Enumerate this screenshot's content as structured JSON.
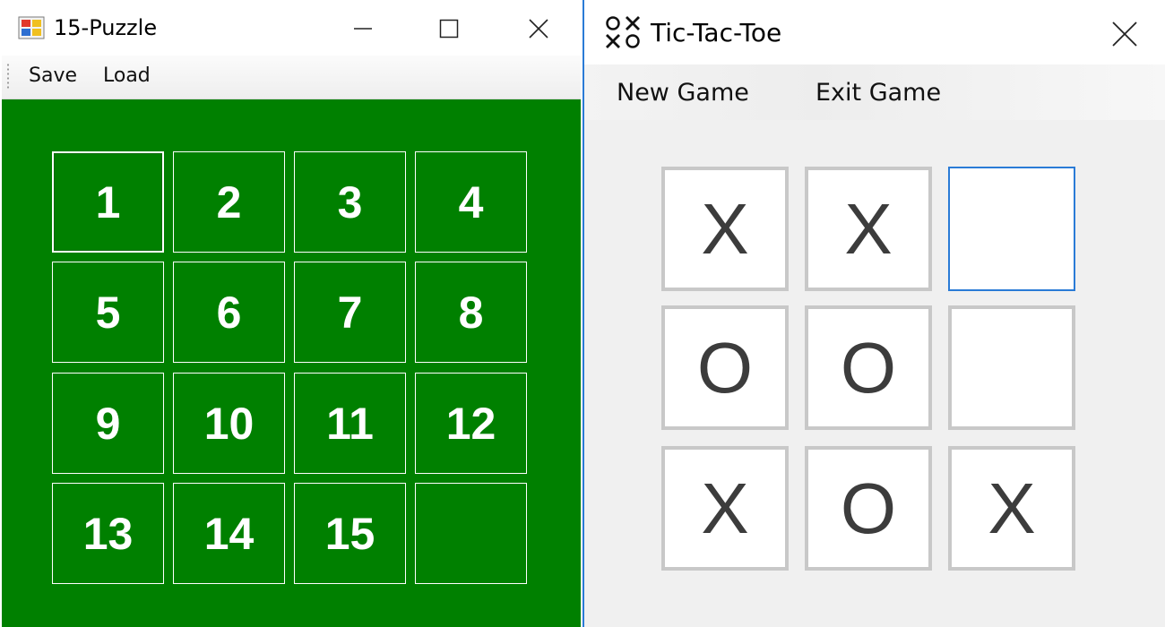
{
  "puzzle_window": {
    "title": "15-Puzzle",
    "menu": {
      "save": "Save",
      "load": "Load"
    },
    "board_color": "#008000",
    "tiles": [
      "1",
      "2",
      "3",
      "4",
      "5",
      "6",
      "7",
      "8",
      "9",
      "10",
      "11",
      "12",
      "13",
      "14",
      "15",
      ""
    ]
  },
  "ttt_window": {
    "title": "Tic-Tac-Toe",
    "menu": {
      "new_game": "New Game",
      "exit_game": "Exit Game"
    },
    "accent": "#2a7bd6",
    "cells": [
      "X",
      "X",
      "",
      "O",
      "O",
      "",
      "X",
      "O",
      "X"
    ]
  },
  "icons": [
    "app-icon",
    "minimize-icon",
    "maximize-icon",
    "close-icon",
    "tic-tac-toe-icon"
  ]
}
